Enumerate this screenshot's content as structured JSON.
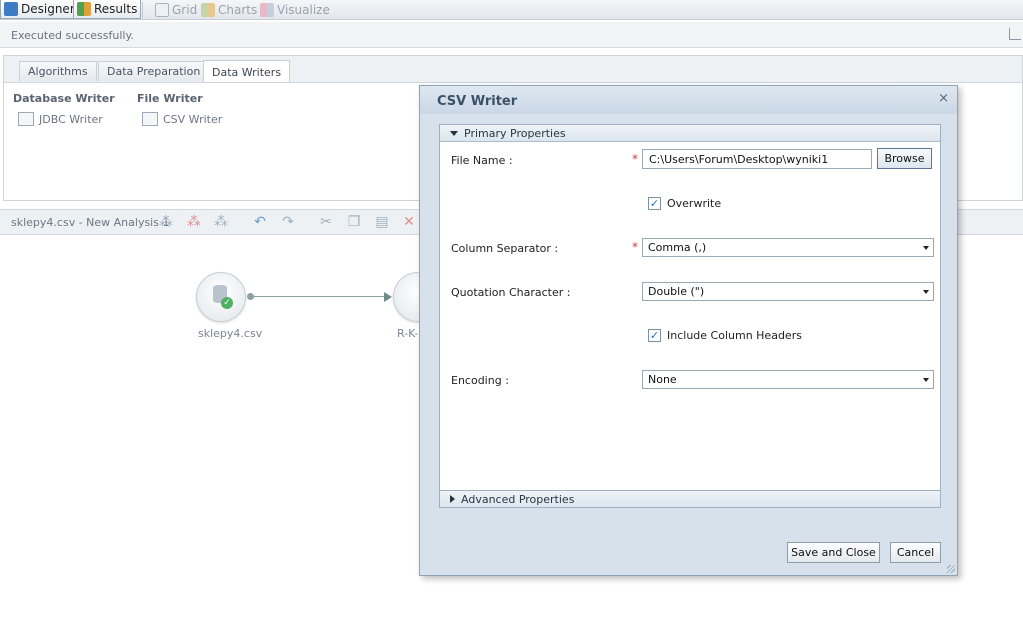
{
  "toolbar": {
    "designer_label": "Designer",
    "results_label": "Results",
    "grid_label": "Grid",
    "charts_label": "Charts",
    "visualize_label": "Visualize"
  },
  "status": {
    "message": "Executed successfully."
  },
  "tabs": [
    {
      "label": "Algorithms"
    },
    {
      "label": "Data Preparation"
    },
    {
      "label": "Data Writers"
    }
  ],
  "palette": {
    "database_writer": {
      "title": "Database Writer",
      "item": "JDBC Writer"
    },
    "file_writer": {
      "title": "File Writer",
      "item": "CSV Writer"
    }
  },
  "analysis": {
    "title": "sklepy4.csv - New Analysis 1",
    "nodes": [
      {
        "label": "sklepy4.csv"
      },
      {
        "label": "R-K-"
      }
    ]
  },
  "dialog": {
    "title": "CSV Writer",
    "primary_section": "Primary Properties",
    "advanced_section": "Advanced Properties",
    "fields": {
      "file_name": {
        "label": "File Name :",
        "value": "C:\\Users\\Forum\\Desktop\\wyniki1",
        "required_mark": "*"
      },
      "overwrite": {
        "label": "Overwrite",
        "checked": true
      },
      "column_separator": {
        "label": "Column Separator :",
        "value": "Comma (,)",
        "required_mark": "*"
      },
      "quotation_character": {
        "label": "Quotation Character :",
        "value": "Double (\")"
      },
      "include_headers": {
        "label": "Include Column Headers",
        "checked": true
      },
      "encoding": {
        "label": "Encoding :",
        "value": "None"
      }
    },
    "browse_label": "Browse",
    "save_label": "Save and Close",
    "cancel_label": "Cancel",
    "close_glyph": "×"
  },
  "colors": {
    "dialog_bg": "#d6e1ec",
    "dialog_title": "#3b5068",
    "required": "#d23a3a",
    "node_ok": "#4fb063"
  }
}
